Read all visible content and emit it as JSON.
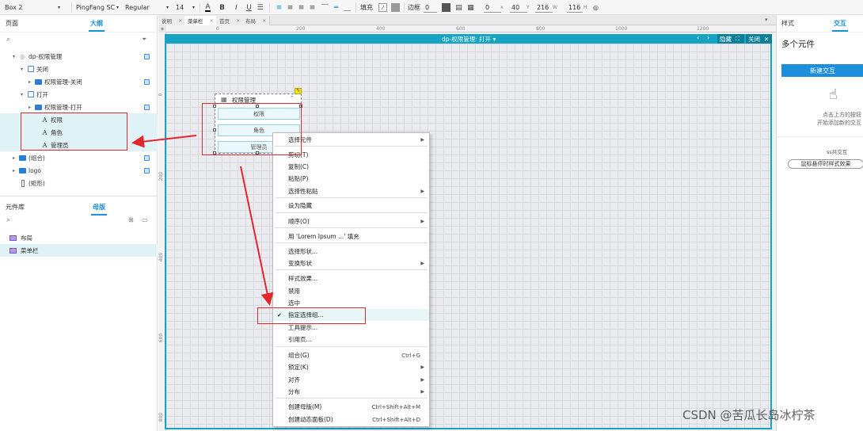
{
  "toolbar": {
    "element_name": "Box 2",
    "font_family": "PingFang SC",
    "font_weight": "Regular",
    "font_size": "14",
    "fill_label": "填充",
    "border_label": "边框",
    "border_value": "0",
    "x_value": "0",
    "x_label": "x",
    "y_value": "40",
    "y_label": "Y",
    "w_value": "216",
    "w_label": "W",
    "h_value": "116",
    "h_label": "H",
    "bold": "B",
    "italic": "I",
    "underline": "U"
  },
  "left_panel": {
    "tab_pages": "页面",
    "tab_outline": "大纲",
    "tree": [
      {
        "label": "dp-权限管理",
        "kind": "page"
      },
      {
        "label": "关闭",
        "kind": "state"
      },
      {
        "label": "权限管理-关闭",
        "kind": "folder"
      },
      {
        "label": "打开",
        "kind": "state"
      },
      {
        "label": "权限管理-打开",
        "kind": "folder"
      },
      {
        "label": "权限",
        "kind": "text"
      },
      {
        "label": "角色",
        "kind": "text"
      },
      {
        "label": "管理员",
        "kind": "text"
      },
      {
        "label": "(组合)",
        "kind": "folder"
      },
      {
        "label": "logo",
        "kind": "folder"
      },
      {
        "label": "(矩形)",
        "kind": "rect"
      }
    ],
    "lib_tab_widgets": "元件库",
    "lib_tab_masters": "母版",
    "masters": [
      {
        "label": "布局"
      },
      {
        "label": "菜单栏"
      }
    ]
  },
  "page_tabs": [
    {
      "label": "说明"
    },
    {
      "label": "菜单栏"
    },
    {
      "label": "首页"
    },
    {
      "label": "布局"
    }
  ],
  "ruler": {
    "top": [
      "0",
      "200",
      "400",
      "600",
      "800",
      "1000",
      "1200"
    ],
    "left": [
      "0",
      "200",
      "400",
      "600",
      "800"
    ]
  },
  "dynamic_panel": {
    "title": "dp-权限管理: 打开 ▾",
    "hide_label": "隐藏",
    "close_label": "关闭"
  },
  "widget": {
    "title": "权限管理",
    "rows": [
      "权限",
      "角色",
      "管理员"
    ]
  },
  "context_menu": {
    "items": [
      {
        "label": "选择元件",
        "submenu": true
      },
      {
        "label": "剪切(T)"
      },
      {
        "label": "复制(C)"
      },
      {
        "label": "粘贴(P)"
      },
      {
        "label": "选择性粘贴",
        "submenu": true
      },
      {
        "label": "设为隐藏"
      },
      {
        "label": "顺序(O)",
        "submenu": true
      },
      {
        "label": "用 'Lorem Ipsum ...' 填充"
      },
      {
        "label": "选择形状..."
      },
      {
        "label": "变换形状",
        "submenu": true
      },
      {
        "label": "样式效果..."
      },
      {
        "label": "禁用"
      },
      {
        "label": "选中"
      },
      {
        "label": "指定选择组...",
        "checked": true
      },
      {
        "label": "工具提示..."
      },
      {
        "label": "引用页..."
      },
      {
        "label": "组合(G)",
        "shortcut": "Ctrl+G"
      },
      {
        "label": "锁定(K)",
        "submenu": true
      },
      {
        "label": "对齐",
        "submenu": true
      },
      {
        "label": "分布",
        "submenu": true
      },
      {
        "label": "创建母版(M)",
        "shortcut": "Ctrl+Shift+Alt+M"
      },
      {
        "label": "创建动态面板(D)",
        "shortcut": "Ctrl+Shift+Alt+D"
      }
    ]
  },
  "right_panel": {
    "tab_style": "样式",
    "tab_interaction": "交互",
    "heading": "多个元件",
    "new_interaction": "新建交互",
    "hint_line1": "点击上方的按钮",
    "hint_line2": "开始添加新的交互",
    "shared_label": "ss共交互",
    "hover_button": "鼠标悬停时样式效果"
  },
  "watermark": "CSDN @苦瓜长岛冰柠茶",
  "colors": {
    "accent": "#1b8edc",
    "panel_teal": "#17a3c2",
    "annotation_red": "#e0282e"
  }
}
